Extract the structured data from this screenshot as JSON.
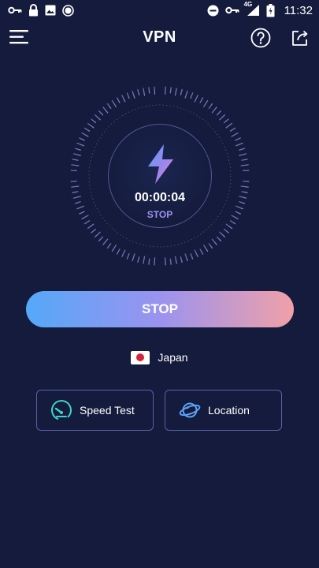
{
  "status_bar": {
    "time": "11:32",
    "network_label": "4G",
    "icons": [
      "key-icon",
      "lock-icon",
      "image-icon",
      "record-icon",
      "do-not-disturb-icon",
      "vpn-key-icon",
      "signal-icon",
      "battery-icon"
    ]
  },
  "app_bar": {
    "title": "VPN",
    "menu_icon": "hamburger-menu-icon",
    "help_icon": "help-circle-icon",
    "share_icon": "share-icon"
  },
  "connection": {
    "timer": "00:00:04",
    "state_label": "STOP",
    "main_button_label": "STOP"
  },
  "server": {
    "country": "Japan",
    "flag_icon": "japan-flag-icon"
  },
  "actions": [
    {
      "label": "Speed Test",
      "icon": "speedometer-icon"
    },
    {
      "label": "Location",
      "icon": "planet-icon"
    }
  ],
  "colors": {
    "background": "#141b3c",
    "gradient_start": "#55a8f8",
    "gradient_mid": "#9b93ef",
    "gradient_end": "#f0a0a8",
    "card_border": "#5563a8",
    "accent_teal": "#3fd3c8"
  }
}
